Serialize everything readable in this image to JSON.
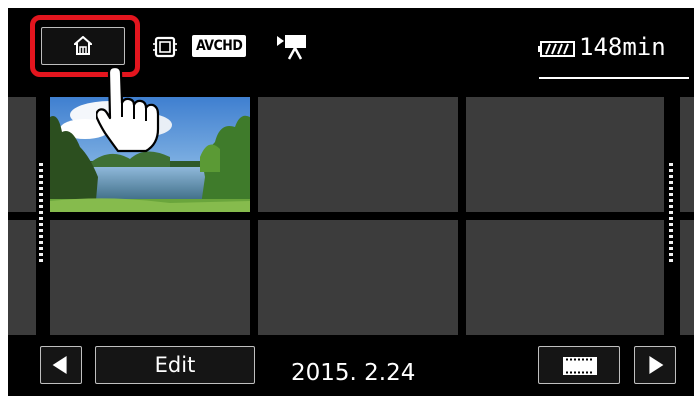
{
  "top_bar": {
    "home_button": {
      "icon": "home-icon"
    },
    "media_icon": "memory-card-icon",
    "format_label": "AVCHD",
    "movie_mode_icon": "movie-camera-icon",
    "battery": {
      "icon": "battery-icon",
      "remaining": "148min"
    }
  },
  "thumbnail": {
    "icon": "lake-landscape-thumbnail"
  },
  "bottom_bar": {
    "prev_icon": "left-arrow-icon",
    "edit_label": "Edit",
    "date": "2015. 2.24",
    "filter_icon": "film-strip-icon",
    "next_icon": "right-arrow-icon"
  },
  "overlay": {
    "highlight_color": "#e3151e",
    "pointer_icon": "pointing-hand-icon"
  }
}
